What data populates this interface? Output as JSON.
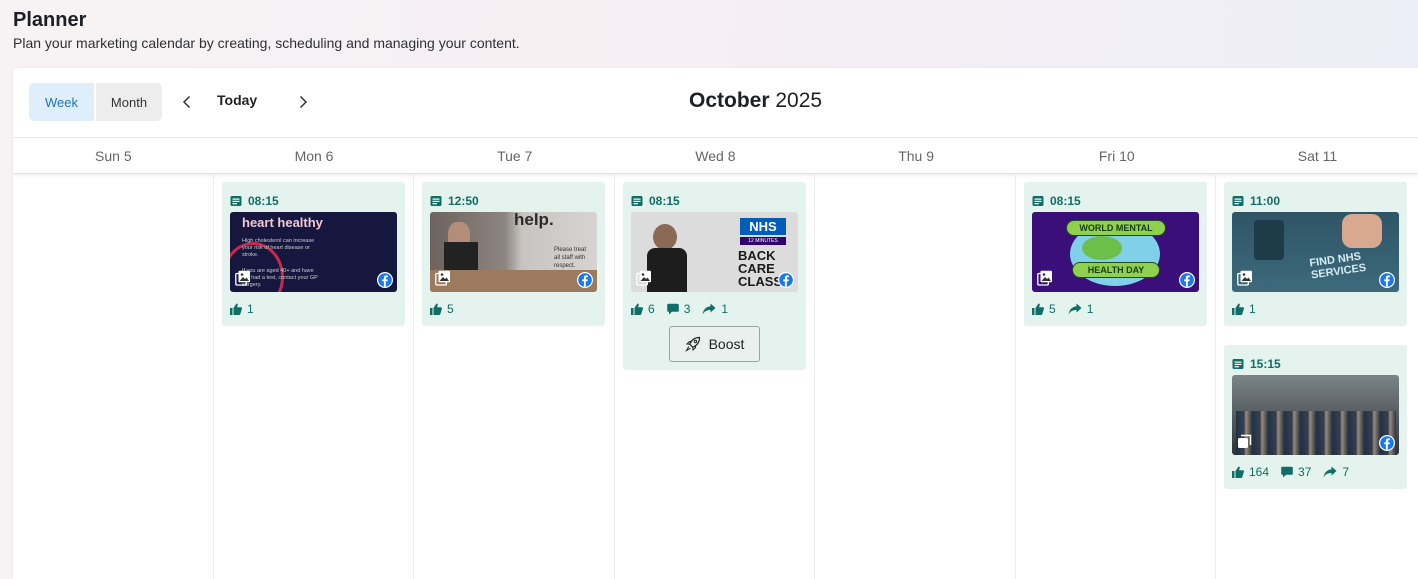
{
  "page": {
    "title": "Planner",
    "subtitle": "Plan your marketing calendar by creating, scheduling and managing your content."
  },
  "toolbar": {
    "week_label": "Week",
    "month_label": "Month",
    "today_label": "Today",
    "month_name": "October",
    "year": "2025"
  },
  "days": [
    "Sun 5",
    "Mon 6",
    "Tue 7",
    "Wed 8",
    "Thu 9",
    "Fri 10",
    "Sat 11"
  ],
  "posts": [
    {
      "time": "08:15",
      "thumb_text_1": "heart healthy",
      "thumb_text_2": "High cholesterol can increase your risk of heart disease or stroke.",
      "thumb_text_3": "If you are aged 40+ and have not had a test, contact your GP surgery.",
      "likes": "1"
    },
    {
      "time": "12:50",
      "thumb_text_1": "help.",
      "thumb_text_2": "Please treat all staff with respect.",
      "likes": "5"
    },
    {
      "time": "08:15",
      "thumb_text_1": "NHS",
      "thumb_text_2": "12 MINUTES",
      "thumb_text_3": "BACK CARE CLASS",
      "likes": "6",
      "comments": "3",
      "shares": "1",
      "boost_label": "Boost"
    },
    {
      "time": "08:15",
      "thumb_text_1": "WORLD MENTAL",
      "thumb_text_2": "HEALTH DAY",
      "likes": "5",
      "shares": "1"
    },
    {
      "time": "11:00",
      "thumb_text_1": "FIND NHS SERVICES",
      "likes": "1"
    },
    {
      "time": "15:15",
      "likes": "164",
      "comments": "37",
      "shares": "7"
    }
  ],
  "colors": {
    "card_bg": "#e4f3ee",
    "accent_teal": "#0f6e66",
    "week_active": "#1f72c4",
    "facebook": "#1877f2"
  }
}
